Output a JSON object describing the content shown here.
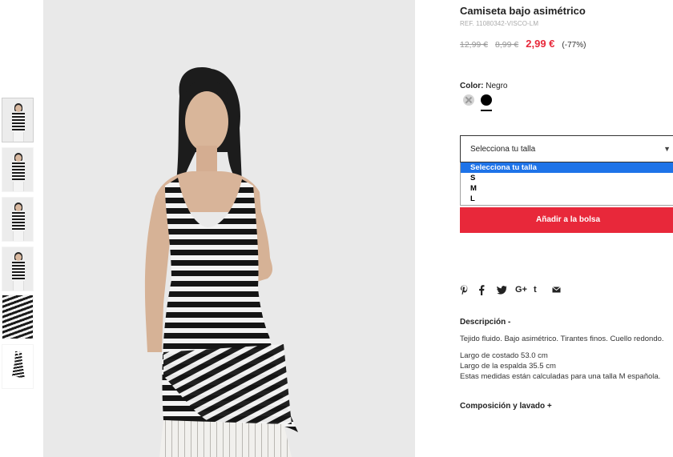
{
  "product": {
    "title": "Camiseta bajo asimétrico",
    "ref": "REF. 11080342-VISCO-LM",
    "price_original": "12,99 €",
    "price_previous": "8,99 €",
    "price_current": "2,99 €",
    "discount": "(-77%)"
  },
  "color": {
    "label": "Color:",
    "value": "Negro",
    "swatches": [
      "unavailable-gray",
      "black"
    ]
  },
  "size": {
    "placeholder": "Selecciona tu talla",
    "options": [
      "Selecciona tu talla",
      "S",
      "M",
      "L"
    ],
    "selected_index": 0
  },
  "cart": {
    "add_label": "Añadir a la bolsa"
  },
  "share": {
    "icons": [
      "pinterest-icon",
      "facebook-icon",
      "twitter-icon",
      "google-plus-icon",
      "tumblr-icon",
      "email-icon"
    ]
  },
  "description": {
    "heading": "Descripción -",
    "text": "Tejido fluido. Bajo asimétrico. Tirantes finos. Cuello redondo.",
    "measures": [
      "Largo de costado 53.0 cm",
      "Largo de la espalda 35.5 cm",
      "Estas medidas están calculadas para una talla M española."
    ]
  },
  "composition": {
    "heading": "Composición y lavado +"
  },
  "colors": {
    "accent": "#e8283a",
    "select_highlight": "#1e73e8",
    "text": "#222222"
  }
}
